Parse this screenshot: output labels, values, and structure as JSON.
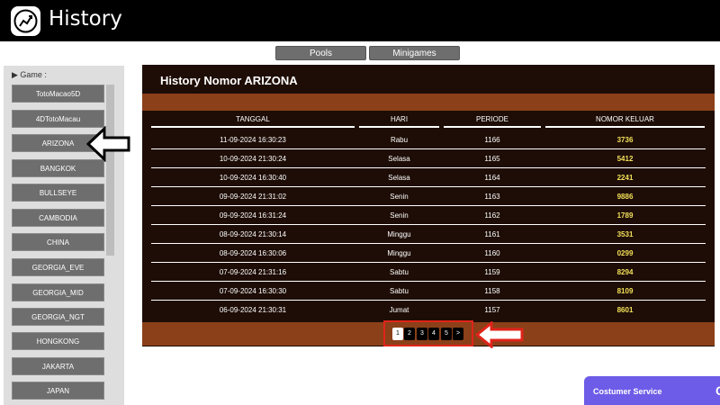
{
  "header": {
    "title": "History"
  },
  "top_tabs": [
    "Pools",
    "Minigames"
  ],
  "sidebar": {
    "label": "▶  Game :",
    "items": [
      "TotoMacao5D",
      "4DTotoMacau",
      "ARIZONA",
      "BANGKOK",
      "BULLSEYE",
      "CAMBODIA",
      "CHINA",
      "GEORGIA_EVE",
      "GEORGIA_MID",
      "GEORGIA_NGT",
      "HONGKONG",
      "JAKARTA",
      "JAPAN"
    ]
  },
  "panel": {
    "title": "History Nomor ARIZONA",
    "columns": [
      "TANGGAL",
      "HARI",
      "PERIODE",
      "NOMOR KELUAR"
    ],
    "rows": [
      [
        "11-09-2024 16:30:23",
        "Rabu",
        "1166",
        "3736"
      ],
      [
        "10-09-2024 21:30:24",
        "Selasa",
        "1165",
        "5412"
      ],
      [
        "10-09-2024 16:30:40",
        "Selasa",
        "1164",
        "2241"
      ],
      [
        "09-09-2024 21:31:02",
        "Senin",
        "1163",
        "9886"
      ],
      [
        "09-09-2024 16:31:24",
        "Senin",
        "1162",
        "1789"
      ],
      [
        "08-09-2024 21:30:14",
        "Minggu",
        "1161",
        "3531"
      ],
      [
        "08-09-2024 16:30:06",
        "Minggu",
        "1160",
        "0299"
      ],
      [
        "07-09-2024 21:31:16",
        "Sabtu",
        "1159",
        "8294"
      ],
      [
        "07-09-2024 16:30:30",
        "Sabtu",
        "1158",
        "8109"
      ],
      [
        "06-09-2024 21:30:31",
        "Jumat",
        "1157",
        "8601"
      ]
    ]
  },
  "pagination": [
    "1",
    "2",
    "3",
    "4",
    "5",
    ">"
  ],
  "customer_service": {
    "label": "Costumer Service",
    "extra": "C"
  },
  "colors": {
    "panel_bg": "#1e0d06",
    "band": "#8b4019",
    "highlight": "#f3e15a",
    "annotation_arrow": "#e0241a",
    "cs_bg": "#6c5ce7"
  },
  "icons": {
    "logo": "chart-icon",
    "pointer": "arrow-left-icon"
  }
}
